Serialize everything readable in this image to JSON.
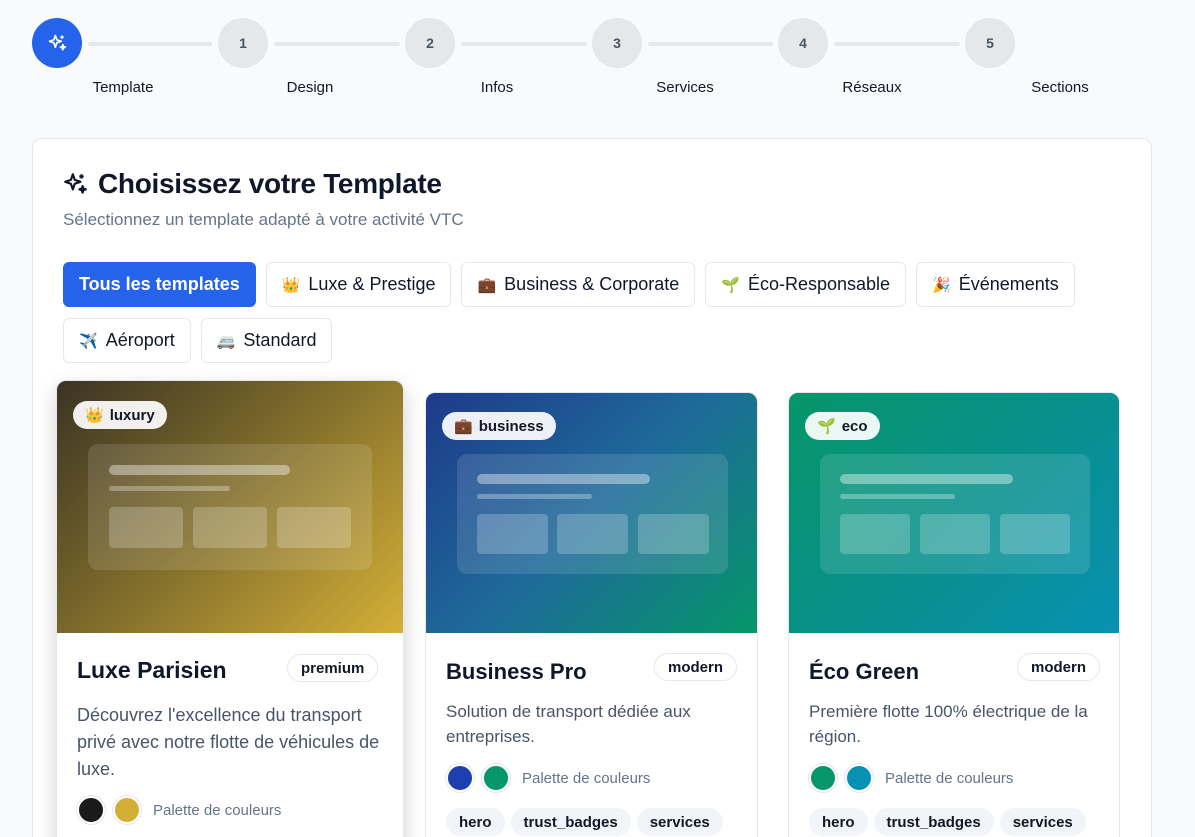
{
  "stepper": {
    "steps": [
      {
        "number": "",
        "label": "Template",
        "icon": "sparkles-icon",
        "active": true
      },
      {
        "number": "1",
        "label": "Design"
      },
      {
        "number": "2",
        "label": "Infos"
      },
      {
        "number": "3",
        "label": "Services"
      },
      {
        "number": "4",
        "label": "Réseaux"
      },
      {
        "number": "5",
        "label": "Sections"
      }
    ]
  },
  "header": {
    "title": "Choisissez votre Template",
    "title_icon": "sparkles-icon",
    "subtitle": "Sélectionnez un template adapté à votre activité VTC"
  },
  "filters": [
    {
      "emoji": "",
      "label": "Tous les templates",
      "active": true
    },
    {
      "emoji": "👑",
      "label": "Luxe & Prestige"
    },
    {
      "emoji": "💼",
      "label": "Business & Corporate"
    },
    {
      "emoji": "🌱",
      "label": "Éco-Responsable"
    },
    {
      "emoji": "🎉",
      "label": "Événements"
    },
    {
      "emoji": "✈️",
      "label": "Aéroport"
    },
    {
      "emoji": "🚐",
      "label": "Standard"
    }
  ],
  "templates": [
    {
      "tag_emoji": "👑",
      "tag": "luxury",
      "name": "Luxe Parisien",
      "style": "premium",
      "description": "Découvrez l'excellence du transport privé avec notre flotte de véhicules de luxe.",
      "palette_label": "Palette de couleurs",
      "colors": [
        "#1a1a1a",
        "#d4af37"
      ],
      "gradient": [
        "#3b3324",
        "#d4af37"
      ],
      "sections": [],
      "selected": true
    },
    {
      "tag_emoji": "💼",
      "tag": "business",
      "name": "Business Pro",
      "style": "modern",
      "description": "Solution de transport dédiée aux entreprises.",
      "palette_label": "Palette de couleurs",
      "colors": [
        "#1e40af",
        "#059669"
      ],
      "gradient": [
        "#1e3a8a",
        "#059669"
      ],
      "sections": [
        "hero",
        "trust_badges",
        "services"
      ]
    },
    {
      "tag_emoji": "🌱",
      "tag": "eco",
      "name": "Éco Green",
      "style": "modern",
      "description": "Première flotte 100% électrique de la région.",
      "palette_label": "Palette de couleurs",
      "colors": [
        "#059669",
        "#0891b2"
      ],
      "gradient": [
        "#059669",
        "#0891b2"
      ],
      "sections": [
        "hero",
        "trust_badges",
        "services"
      ]
    }
  ]
}
